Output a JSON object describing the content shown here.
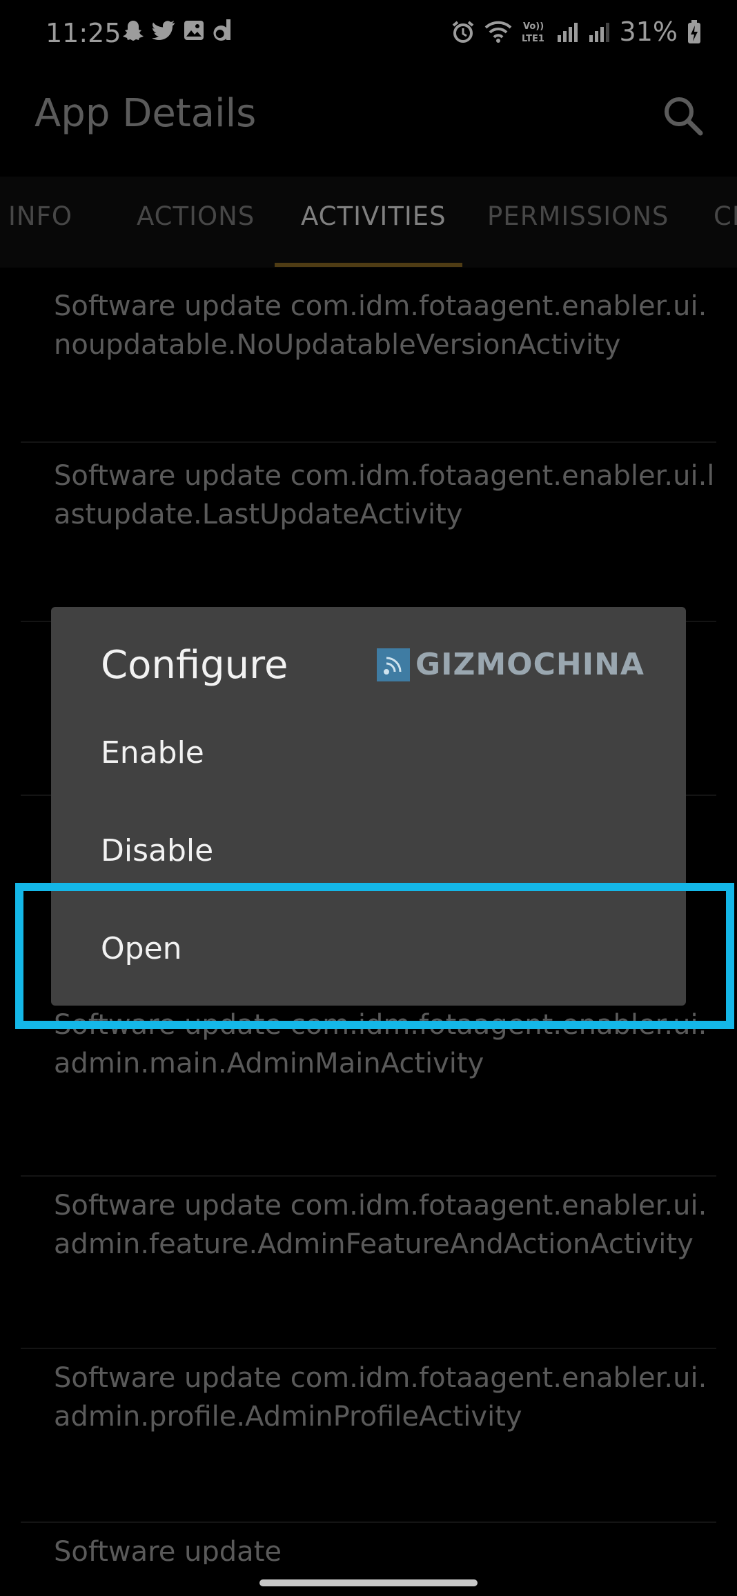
{
  "status_bar": {
    "time": "11:25",
    "battery": "31%",
    "icons_left": [
      "snapchat-icon",
      "twitter-icon",
      "gallery-icon",
      "dailyhunt-icon"
    ],
    "icons_right": [
      "alarm-icon",
      "wifi-icon",
      "volte-icon",
      "signal-icon",
      "signal-icon",
      "battery-charging-icon"
    ],
    "volte_label": "Vo)) LTE1"
  },
  "app_bar": {
    "title": "App Details",
    "search_icon": "search-icon"
  },
  "tabs": [
    {
      "label": "INFO",
      "active": false
    },
    {
      "label": "ACTIONS",
      "active": false
    },
    {
      "label": "ACTIVITIES",
      "active": true
    },
    {
      "label": "PERMISSIONS",
      "active": false
    },
    {
      "label": "CE",
      "active": false
    }
  ],
  "list": {
    "items": [
      {
        "text": "Software update com.idm.fotaagent.enabler.ui.noupdatable.NoUpdatableVersionActivity"
      },
      {
        "text": "Software update com.idm.fotaagent.enabler.ui.lastupdate.LastUpdateActivity"
      },
      {
        "text": "Software update com.idm.fotaagent.enabler.ui.admin.main.AdminMainActivity"
      },
      {
        "text": "Software update com.idm.fotaagent.enabler.ui.admin.feature.AdminFeatureAndActionActivity"
      },
      {
        "text": "Software update com.idm.fotaagent.enabler.ui.admin.profile.AdminProfileActivity"
      },
      {
        "text": "Software update"
      }
    ]
  },
  "dialog": {
    "title": "Configure",
    "options": [
      "Enable",
      "Disable",
      "Open"
    ],
    "watermark": "GIZMOCHINA"
  },
  "colors": {
    "highlight": "#14b7e8",
    "tab_indicator": "#7a5c20",
    "dialog_bg": "#414141"
  }
}
